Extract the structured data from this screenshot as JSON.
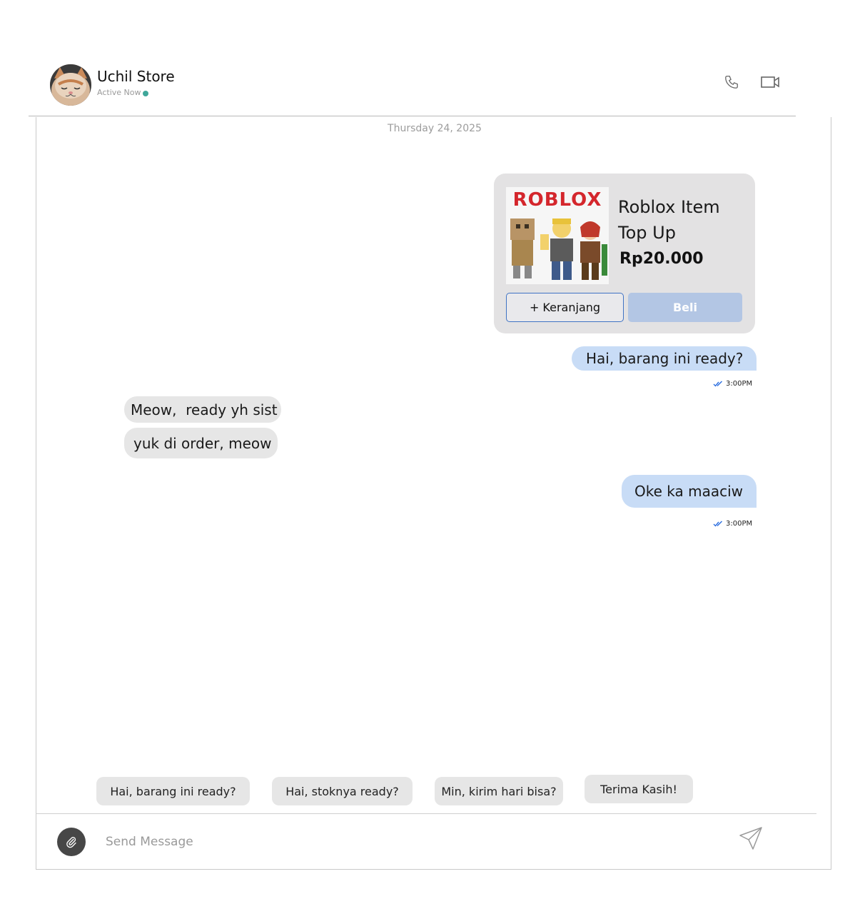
{
  "header": {
    "store_name": "Uchil Store",
    "status": "Active Now",
    "status_color": "#3fa79a"
  },
  "conversation": {
    "date": "Thursday 24, 2025",
    "product": {
      "title": "Roblox Item Top Up",
      "price": "Rp20.000",
      "image_logo": "ROBLOX",
      "cart_label": "+ Keranjang",
      "buy_label": "Beli"
    },
    "messages": [
      {
        "text": "Hai, barang ini ready?",
        "time": "3:00PM"
      },
      {
        "text": "Meow,  ready yh sist"
      },
      {
        "text": "yuk di order, meow"
      },
      {
        "text": "Oke ka maaciw",
        "time": "3:00PM"
      }
    ]
  },
  "quick_replies": [
    "Hai, barang ini ready?",
    "Hai, stoknya ready?",
    "Min, kirim hari bisa?",
    "Terima Kasih!"
  ],
  "composer": {
    "placeholder": "Send Message"
  },
  "colors": {
    "outgoing_bubble": "#c8dcf6",
    "incoming_bubble": "#e6e6e6",
    "card_bg": "#e3e2e3",
    "buy_button": "#b3c6e4",
    "cart_border": "#3f73c4",
    "read_check": "#2d6fe0"
  }
}
